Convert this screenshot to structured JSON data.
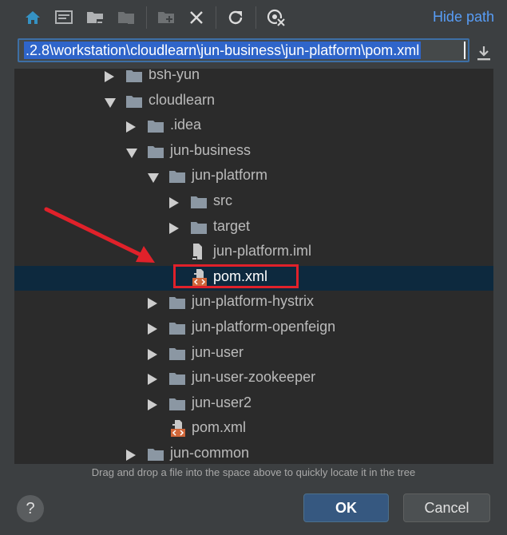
{
  "toolbar": {
    "buttons": [
      {
        "name": "home-icon"
      },
      {
        "name": "desktop-icon"
      },
      {
        "name": "project-folder-icon"
      },
      {
        "name": "module-folder-icon"
      },
      {
        "name": "new-folder-icon"
      },
      {
        "name": "delete-icon"
      },
      {
        "name": "refresh-icon"
      },
      {
        "name": "show-hidden-icon"
      }
    ],
    "hide_path_label": "Hide path"
  },
  "path": {
    "value": ".2.8\\workstation\\cloudlearn\\jun-business\\jun-platform\\pom.xml"
  },
  "tree": {
    "items": [
      {
        "label": "bsh-yun",
        "kind": "folder",
        "state": "collapsed"
      },
      {
        "label": "cloudlearn",
        "kind": "folder",
        "state": "expanded"
      },
      {
        "label": ".idea",
        "kind": "folder",
        "state": "collapsed"
      },
      {
        "label": "jun-business",
        "kind": "folder",
        "state": "expanded"
      },
      {
        "label": "jun-platform",
        "kind": "folder",
        "state": "expanded"
      },
      {
        "label": "src",
        "kind": "folder",
        "state": "collapsed"
      },
      {
        "label": "target",
        "kind": "folder",
        "state": "collapsed"
      },
      {
        "label": "jun-platform.iml",
        "kind": "iml-file",
        "state": "leaf"
      },
      {
        "label": "pom.xml",
        "kind": "xml-file",
        "state": "leaf",
        "selected": true
      },
      {
        "label": "jun-platform-hystrix",
        "kind": "folder",
        "state": "collapsed"
      },
      {
        "label": "jun-platform-openfeign",
        "kind": "folder",
        "state": "collapsed"
      },
      {
        "label": "jun-user",
        "kind": "folder",
        "state": "collapsed"
      },
      {
        "label": "jun-user-zookeeper",
        "kind": "folder",
        "state": "collapsed"
      },
      {
        "label": "jun-user2",
        "kind": "folder",
        "state": "collapsed"
      },
      {
        "label": "pom.xml",
        "kind": "xml-file",
        "state": "leaf"
      },
      {
        "label": "jun-common",
        "kind": "folder",
        "state": "collapsed"
      }
    ]
  },
  "hint": "Drag and drop a file into the space above to quickly locate it in the tree",
  "footer": {
    "help_label": "?",
    "ok_label": "OK",
    "cancel_label": "Cancel"
  },
  "colors": {
    "accent_link": "#589df6",
    "selection": "#0d293e",
    "highlight_box": "#e0212a",
    "folder": "#8b97a3",
    "xml": "#d0673a"
  }
}
